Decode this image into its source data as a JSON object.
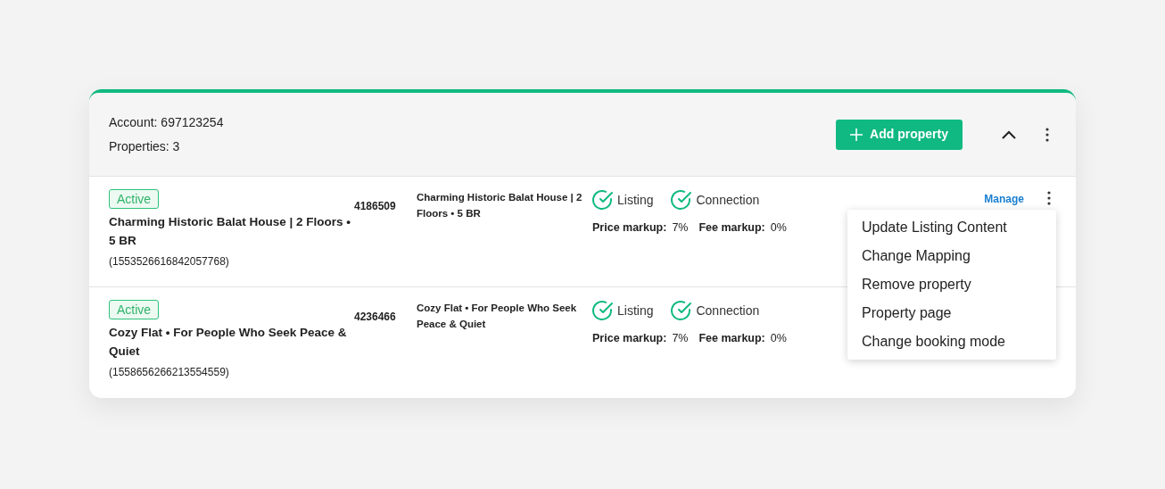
{
  "account": {
    "label": "Account: 697123254",
    "properties": "Properties: 3",
    "add_button": "Add property",
    "expanded": true
  },
  "rows": [
    {
      "status": "Active",
      "active": true,
      "title": "Charming Historic Balat House | 2 Floors • 5 BR",
      "external_id": "(1553526616842057768)",
      "code": "4186509",
      "listing_title": "Charming Historic Balat House | 2 Floors • 5 BR",
      "checks": [
        {
          "label": "Listing",
          "ok": true
        },
        {
          "label": "Connection",
          "ok": true
        }
      ],
      "price_label": "Price markup:",
      "price": "7%",
      "fee_label": "Fee markup:",
      "fee": "0%",
      "manage": "Manage"
    },
    {
      "status": "Active",
      "active": true,
      "title": "Cozy Flat • For People Who Seek Peace & Quiet",
      "external_id": "(1558656266213554559)",
      "code": "4236466",
      "listing_title": "Cozy Flat • For People Who Seek Peace & Quiet",
      "checks": [
        {
          "label": "Listing",
          "ok": true
        },
        {
          "label": "Connection",
          "ok": true
        }
      ],
      "price_label": "Price markup:",
      "price": "7%",
      "fee_label": "Fee markup:",
      "fee": "0%"
    }
  ],
  "menu": [
    "Update Listing Content",
    "Change Mapping",
    "Remove property",
    "Property page",
    "Change booking mode"
  ]
}
